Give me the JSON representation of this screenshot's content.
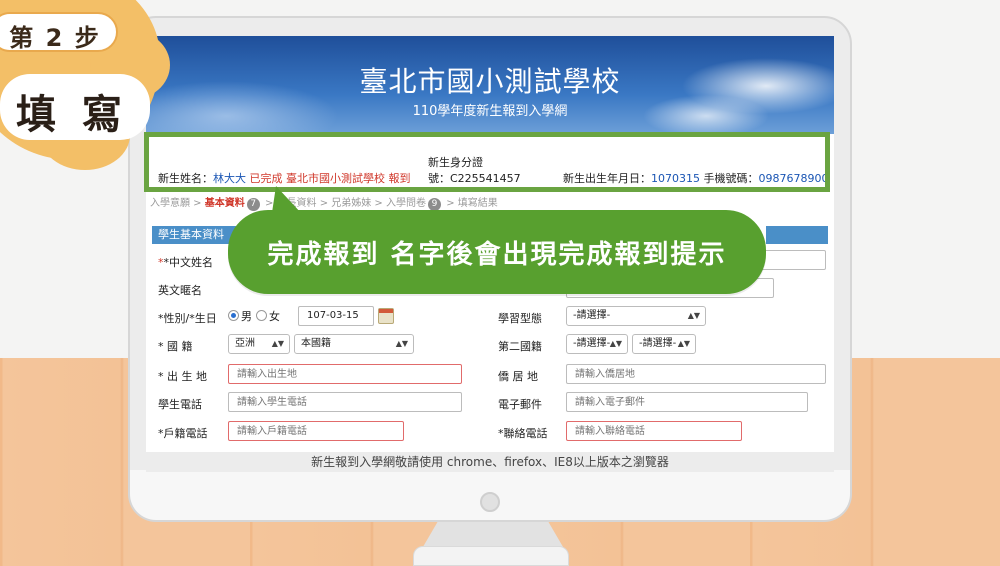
{
  "step_badge": {
    "step": "第 2 步",
    "action": "填 寫"
  },
  "banner": {
    "title": "臺北市國小測試學校",
    "subtitle": "110學年度新生報到入學網"
  },
  "info": {
    "name_label": "新生姓名：",
    "name_value": "林大大",
    "status_text": "已完成",
    "school_text": "臺北市國小測試學校",
    "report_text": "報到",
    "id_label_line1": "新生身分證",
    "id_label_line2": "號：",
    "id_value": "C225541457",
    "birth_label": "新生出生年月日：",
    "birth_value": "1070315",
    "phone_label": "手機號碼：",
    "phone_value": "0987678900"
  },
  "steps": [
    {
      "label": "入學意願 >",
      "num": "",
      "current": false
    },
    {
      "label": "基本資料",
      "num": "7",
      "current": true
    },
    {
      "label": "> 家長資料",
      "num": "",
      "current": false
    },
    {
      "label": "> 兄弟姊妹 >",
      "num": "",
      "current": false
    },
    {
      "label": "入學問卷",
      "num": "9",
      "current": false
    },
    {
      "label": "> 填寫結果",
      "num": "",
      "current": false
    }
  ],
  "section": {
    "title": "學生基本資料"
  },
  "form": {
    "chinese_name_label": "*中文姓名",
    "english_name_label": "英文暱名",
    "gender_birth_label": "*性別/*生日",
    "gender_male": "男",
    "gender_female": "女",
    "birthday_value": "107-03-15",
    "learning_type_label": "學習型態",
    "learning_type_value": "-請選擇-",
    "nationality_label": "* 國  籍",
    "continent_value": "亞洲",
    "country_value": "本國籍",
    "second_nationality_label": "第二國籍",
    "second_nat_1_value": "-請選擇-",
    "second_nat_2_value": "-請選擇-",
    "birthplace_label": "* 出 生 地",
    "birthplace_placeholder": "請輸入出生地",
    "residence_label": "僑 居 地",
    "residence_placeholder": "請輸入僑居地",
    "student_phone_label": "學生電話",
    "student_phone_placeholder": "請輸入學生電話",
    "email_label": "電子郵件",
    "email_placeholder": "請輸入電子郵件",
    "household_phone_label": "*戶籍電話",
    "household_phone_placeholder": "請輸入戶籍電話",
    "contact_phone_label": "*聯絡電話",
    "contact_phone_placeholder": "請輸入聯絡電話"
  },
  "footer": {
    "text": "新生報到入學網敬請使用 chrome、firefox、IE8以上版本之瀏覽器"
  },
  "callout": {
    "text": "完成報到  名字後會出現完成報到提示"
  },
  "colors": {
    "accent_green": "#58a02f",
    "frame_green": "#6aa441",
    "banner_blue": "#3a78c4",
    "required_red": "#d0382b"
  }
}
